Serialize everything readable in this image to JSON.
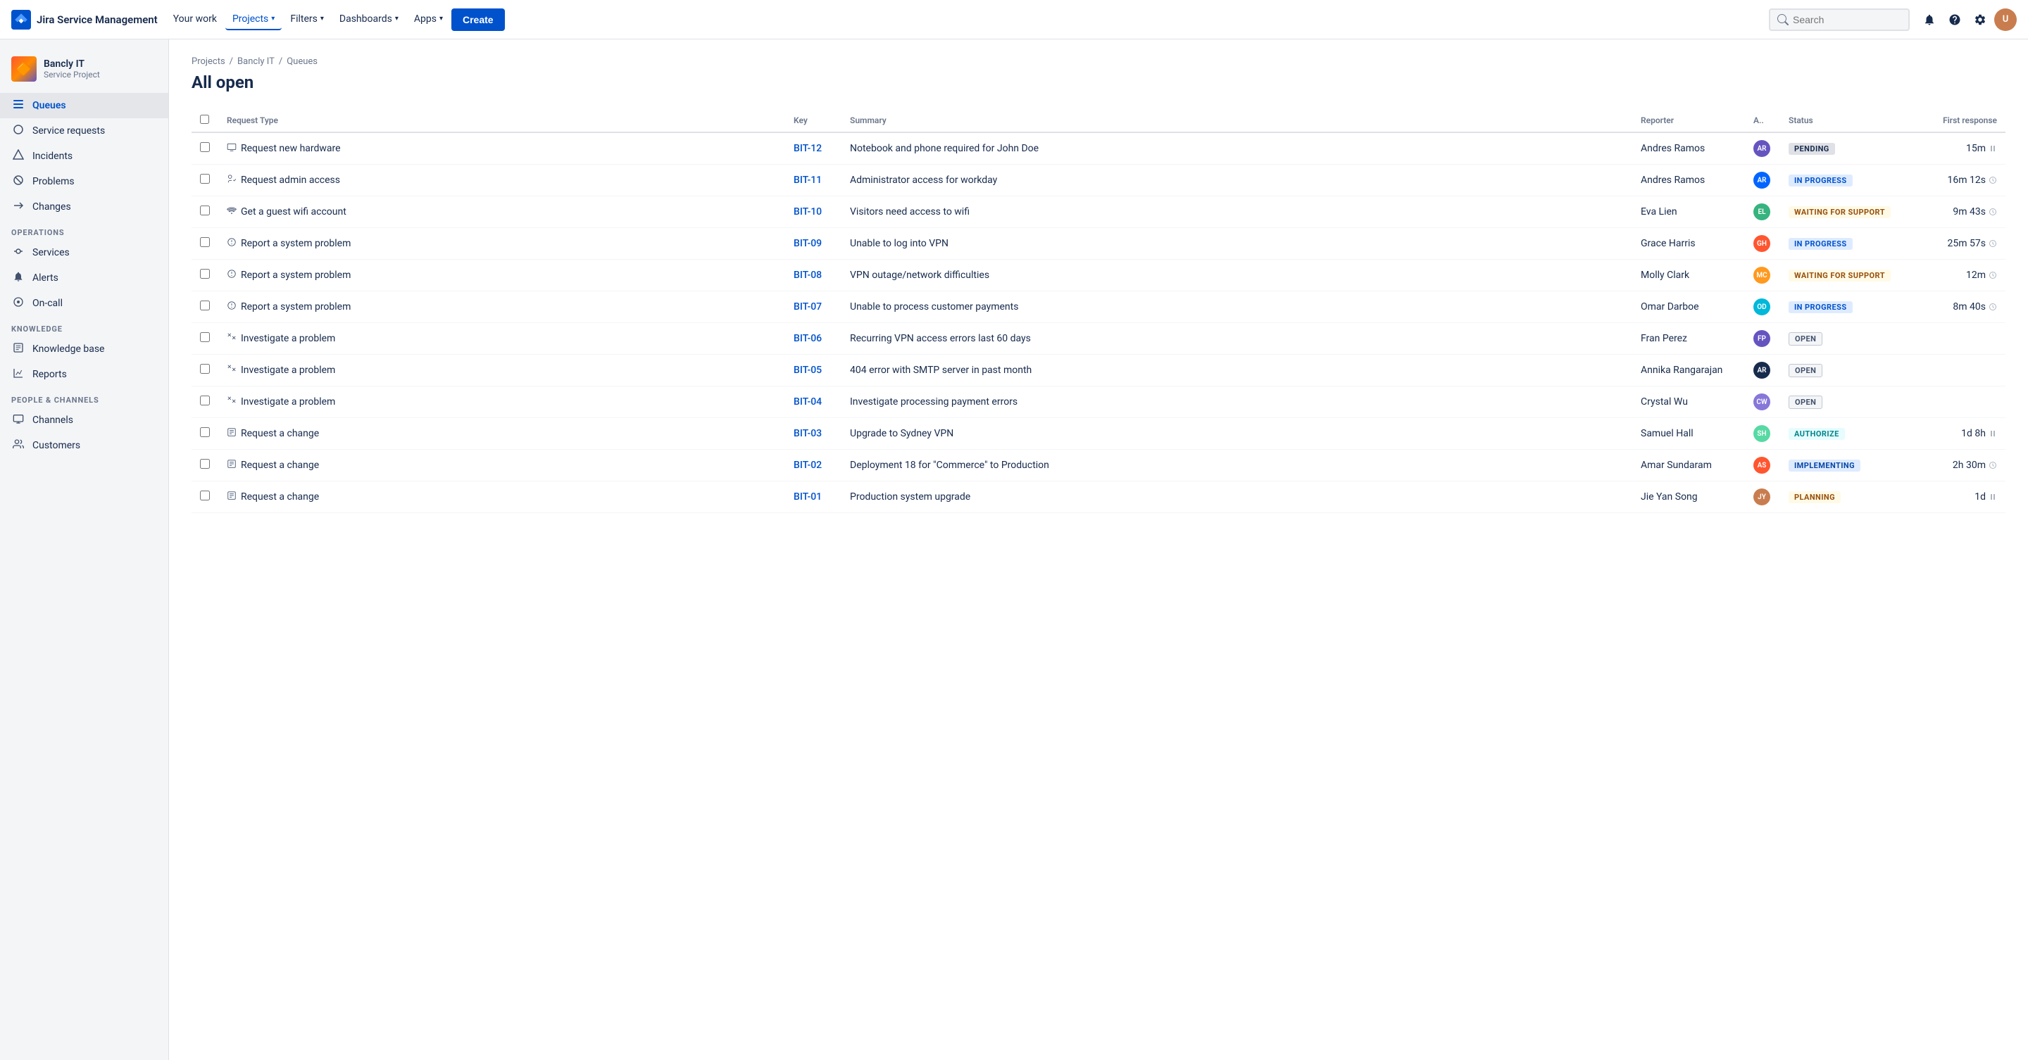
{
  "topnav": {
    "brand": "Jira Service Management",
    "nav_items": [
      {
        "label": "Your work",
        "active": false
      },
      {
        "label": "Projects",
        "active": true,
        "has_dropdown": true
      },
      {
        "label": "Filters",
        "active": false,
        "has_dropdown": true
      },
      {
        "label": "Dashboards",
        "active": false,
        "has_dropdown": true
      },
      {
        "label": "Apps",
        "active": false,
        "has_dropdown": true
      }
    ],
    "create_label": "Create",
    "search_placeholder": "Search"
  },
  "sidebar": {
    "project_name": "Bancly IT",
    "project_type": "Service Project",
    "nav_items": [
      {
        "label": "Queues",
        "active": true,
        "icon": "☰"
      },
      {
        "label": "Service requests",
        "active": false,
        "icon": "○"
      },
      {
        "label": "Incidents",
        "active": false,
        "icon": "△"
      },
      {
        "label": "Problems",
        "active": false,
        "icon": "⊘"
      },
      {
        "label": "Changes",
        "active": false,
        "icon": "↺"
      }
    ],
    "operations_label": "OPERATIONS",
    "operations_items": [
      {
        "label": "Services",
        "icon": "⇄"
      },
      {
        "label": "Alerts",
        "icon": "🔔"
      },
      {
        "label": "On-call",
        "icon": "⊕"
      }
    ],
    "knowledge_label": "KNOWLEDGE",
    "knowledge_items": [
      {
        "label": "Knowledge base",
        "icon": "📄"
      },
      {
        "label": "Reports",
        "icon": "📊"
      }
    ],
    "people_label": "PEOPLE & CHANNELS",
    "people_items": [
      {
        "label": "Channels",
        "icon": "🖥"
      },
      {
        "label": "Customers",
        "icon": "👥"
      }
    ]
  },
  "breadcrumb": {
    "parts": [
      "Projects",
      "Bancly IT",
      "Queues"
    ]
  },
  "page_title": "All open",
  "table": {
    "columns": [
      "Request Type",
      "Key",
      "Summary",
      "Reporter",
      "A..",
      "Status",
      "First response"
    ],
    "rows": [
      {
        "type": "Request new hardware",
        "type_icon": "💻",
        "key": "BIT-12",
        "summary": "Notebook and phone required for John Doe",
        "reporter": "Andres Ramos",
        "avatar_class": "av-1",
        "avatar_initials": "AR",
        "status": "PENDING",
        "status_class": "badge-pending",
        "response": "15m",
        "response_icon": "pause"
      },
      {
        "type": "Request admin access",
        "type_icon": "🔑",
        "key": "BIT-11",
        "summary": "Administrator access for workday",
        "reporter": "Andres Ramos",
        "avatar_class": "av-2",
        "avatar_initials": "AR",
        "status": "IN PROGRESS",
        "status_class": "badge-in-progress",
        "response": "16m 12s",
        "response_icon": "clock"
      },
      {
        "type": "Get a guest wifi account",
        "type_icon": "📶",
        "key": "BIT-10",
        "summary": "Visitors need access to wifi",
        "reporter": "Eva Lien",
        "avatar_class": "av-3",
        "avatar_initials": "EL",
        "status": "WAITING FOR SUPPORT",
        "status_class": "badge-waiting",
        "response": "9m 43s",
        "response_icon": "clock"
      },
      {
        "type": "Report a system problem",
        "type_icon": "⏱",
        "key": "BIT-09",
        "summary": "Unable to log into VPN",
        "reporter": "Grace Harris",
        "avatar_class": "av-4",
        "avatar_initials": "GH",
        "status": "IN PROGRESS",
        "status_class": "badge-in-progress",
        "response": "25m 57s",
        "response_icon": "clock"
      },
      {
        "type": "Report a system problem",
        "type_icon": "⏱",
        "key": "BIT-08",
        "summary": "VPN outage/network difficulties",
        "reporter": "Molly Clark",
        "avatar_class": "av-5",
        "avatar_initials": "MC",
        "status": "WAITING FOR SUPPORT",
        "status_class": "badge-waiting",
        "response": "12m",
        "response_icon": "clock"
      },
      {
        "type": "Report a system problem",
        "type_icon": "⏱",
        "key": "BIT-07",
        "summary": "Unable to process customer payments",
        "reporter": "Omar Darboe",
        "avatar_class": "av-6",
        "avatar_initials": "OD",
        "status": "IN PROGRESS",
        "status_class": "badge-in-progress",
        "response": "8m 40s",
        "response_icon": "clock"
      },
      {
        "type": "Investigate a problem",
        "type_icon": "✂",
        "key": "BIT-06",
        "summary": "Recurring VPN access errors last 60 days",
        "reporter": "Fran Perez",
        "avatar_class": "av-7",
        "avatar_initials": "FP",
        "status": "OPEN",
        "status_class": "badge-open",
        "response": "",
        "response_icon": ""
      },
      {
        "type": "Investigate a problem",
        "type_icon": "✂",
        "key": "BIT-05",
        "summary": "404 error with SMTP server in past month",
        "reporter": "Annika Rangarajan",
        "avatar_class": "av-8",
        "avatar_initials": "AR",
        "status": "OPEN",
        "status_class": "badge-open",
        "response": "",
        "response_icon": ""
      },
      {
        "type": "Investigate a problem",
        "type_icon": "✂",
        "key": "BIT-04",
        "summary": "Investigate processing payment errors",
        "reporter": "Crystal Wu",
        "avatar_class": "av-9",
        "avatar_initials": "CW",
        "status": "OPEN",
        "status_class": "badge-open",
        "response": "",
        "response_icon": ""
      },
      {
        "type": "Request a change",
        "type_icon": "📋",
        "key": "BIT-03",
        "summary": "Upgrade to Sydney VPN",
        "reporter": "Samuel Hall",
        "avatar_class": "av-10",
        "avatar_initials": "SH",
        "status": "AUTHORIZE",
        "status_class": "badge-authorize",
        "response": "1d 8h",
        "response_icon": "pause"
      },
      {
        "type": "Request a change",
        "type_icon": "📋",
        "key": "BIT-02",
        "summary": "Deployment 18 for \"Commerce\" to Production",
        "reporter": "Amar Sundaram",
        "avatar_class": "av-11",
        "avatar_initials": "AS",
        "status": "IMPLEMENTING",
        "status_class": "badge-implementing",
        "response": "2h 30m",
        "response_icon": "clock"
      },
      {
        "type": "Request a change",
        "type_icon": "📋",
        "key": "BIT-01",
        "summary": "Production system upgrade",
        "reporter": "Jie Yan Song",
        "avatar_class": "av-12",
        "avatar_initials": "JY",
        "status": "PLANNING",
        "status_class": "badge-planning",
        "response": "1d",
        "response_icon": "pause"
      }
    ]
  }
}
